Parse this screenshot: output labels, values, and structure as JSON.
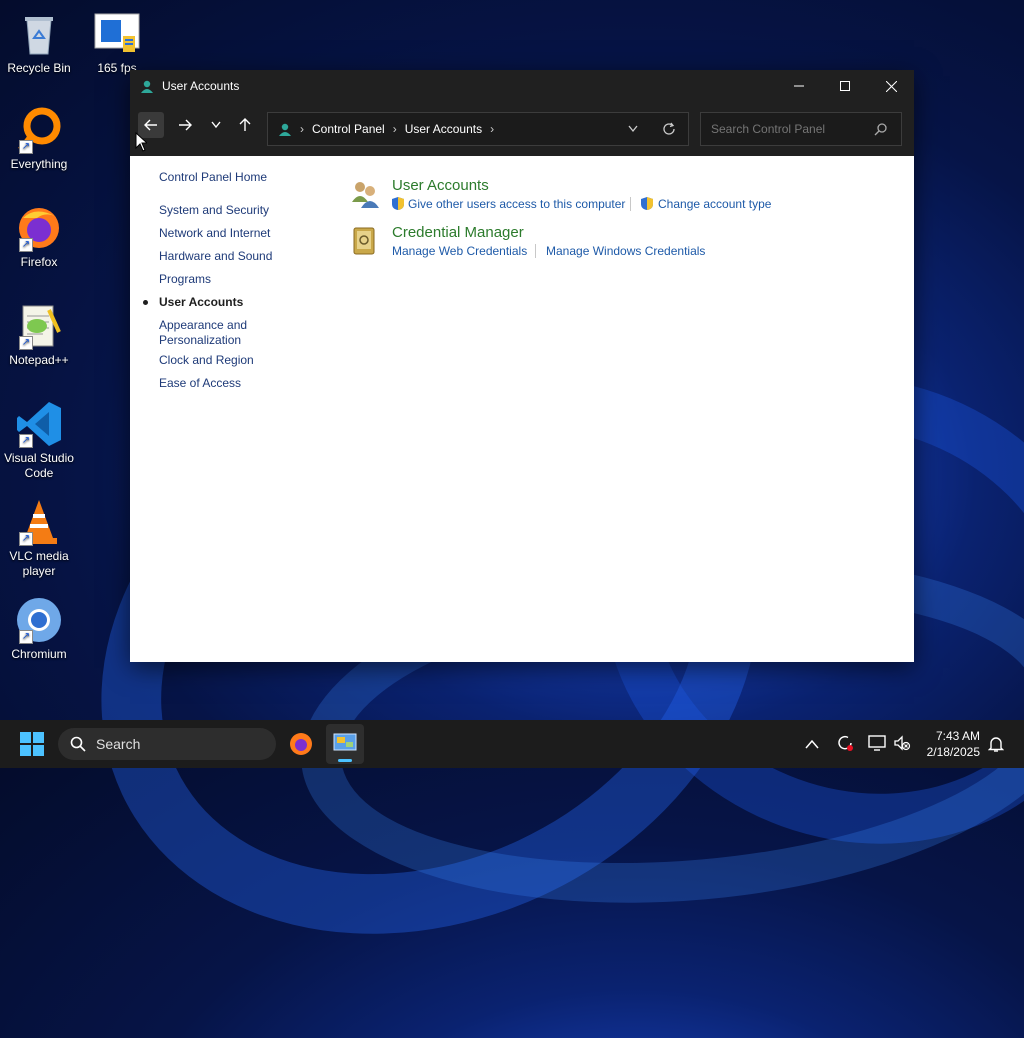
{
  "desktop": {
    "icons": [
      {
        "label": "Recycle Bin",
        "icon": "recycle-bin-icon"
      },
      {
        "label": "165 fps",
        "icon": "fps-app-icon"
      },
      {
        "label": "Everything",
        "icon": "everything-search-icon"
      },
      {
        "label": "Firefox",
        "icon": "firefox-icon"
      },
      {
        "label": "Notepad++",
        "icon": "notepadpp-icon"
      },
      {
        "label": "Visual Studio Code",
        "icon": "vscode-icon"
      },
      {
        "label": "VLC media player",
        "icon": "vlc-icon"
      },
      {
        "label": "Chromium",
        "icon": "chromium-icon"
      }
    ]
  },
  "window": {
    "title": "User Accounts",
    "address": {
      "segments": [
        "Control Panel",
        "User Accounts"
      ]
    },
    "search": {
      "placeholder": "Search Control Panel"
    },
    "sidebar": {
      "items": [
        {
          "label": "Control Panel Home"
        },
        {
          "label": "System and Security"
        },
        {
          "label": "Network and Internet"
        },
        {
          "label": "Hardware and Sound"
        },
        {
          "label": "Programs"
        },
        {
          "label": "User Accounts",
          "current": true
        },
        {
          "label": "Appearance and"
        },
        {
          "label": "Personalization"
        },
        {
          "label": "Clock and Region"
        },
        {
          "label": "Ease of Access"
        }
      ]
    },
    "categories": [
      {
        "title": "User Accounts",
        "links": [
          "Give other users access to this computer",
          "Change account type"
        ]
      },
      {
        "title": "Credential Manager",
        "links": [
          "Manage Web Credentials",
          "Manage Windows Credentials"
        ]
      }
    ]
  },
  "taskbar": {
    "search_label": "Search",
    "time": "7:43 AM",
    "date": "2/18/2025"
  },
  "colors": {
    "link": "#1e5aa8",
    "category_title": "#2c7b2c",
    "titlebar": "#202020",
    "taskbar": "#1c1c1c"
  }
}
